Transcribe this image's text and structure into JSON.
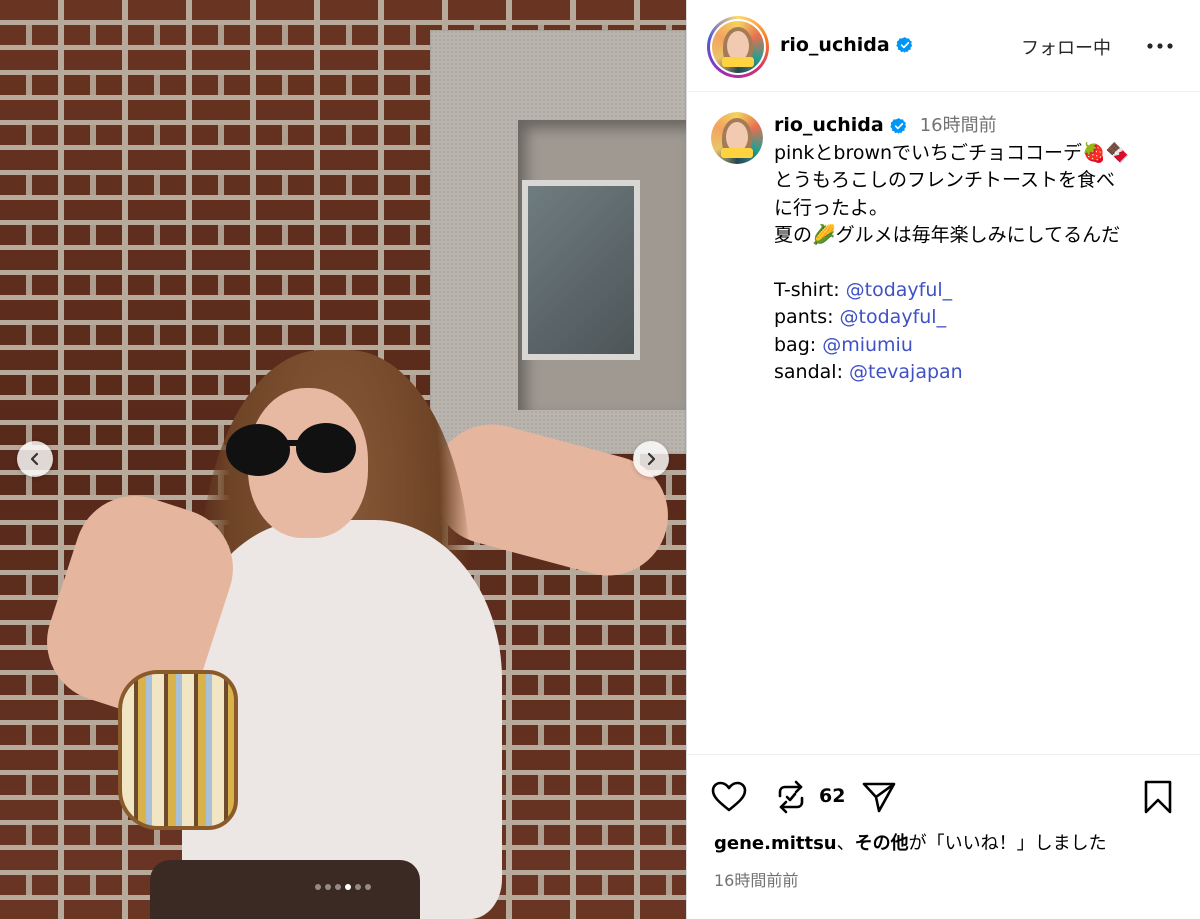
{
  "post": {
    "media_alt_counter": 6,
    "slides_total": 6,
    "active_slide_index": 3
  },
  "icons": {
    "prev": "chevron-left-icon",
    "next": "chevron-right-icon",
    "verified": "verified-badge-icon",
    "more": "more-horizontal-icon",
    "like": "heart-icon",
    "repost": "repost-icon",
    "share": "paper-plane-icon",
    "save": "bookmark-icon"
  },
  "colors": {
    "verified": "#0095f6",
    "mention": "#3f51c5",
    "muted": "#737373"
  },
  "header": {
    "username": "rio_uchida",
    "follow_status": "フォロー中"
  },
  "caption": {
    "username": "rio_uchida",
    "time_ago": "16時間前",
    "lines": [
      "pinkとbrownでいちごチョココーデ🍓🍫",
      "とうもろこしのフレンチトーストを食べ",
      "に行ったよ。",
      "夏の🌽グルメは毎年楽しみにしてるんだ"
    ],
    "credits": [
      {
        "label": "T-shirt: ",
        "mention": "@todayful_"
      },
      {
        "label": "pants: ",
        "mention": "@todayful_"
      },
      {
        "label": "bag: ",
        "mention": "@miumiu"
      },
      {
        "label": "sandal: ",
        "mention": "@tevajapan"
      }
    ]
  },
  "footer": {
    "repost_count": "62",
    "likes_user": "gene.mittsu",
    "likes_sep": "、",
    "likes_others": "その他",
    "likes_suffix": "が「いいね！」しました",
    "posted": "16時間前前"
  }
}
